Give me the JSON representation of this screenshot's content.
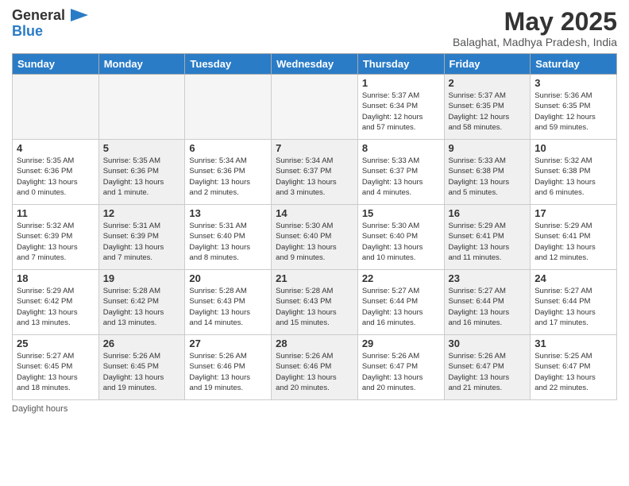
{
  "header": {
    "logo_line1": "General",
    "logo_line2": "Blue",
    "month_title": "May 2025",
    "location": "Balaghat, Madhya Pradesh, India"
  },
  "days_of_week": [
    "Sunday",
    "Monday",
    "Tuesday",
    "Wednesday",
    "Thursday",
    "Friday",
    "Saturday"
  ],
  "weeks": [
    [
      {
        "day": "",
        "info": "",
        "shaded": false,
        "empty": true
      },
      {
        "day": "",
        "info": "",
        "shaded": false,
        "empty": true
      },
      {
        "day": "",
        "info": "",
        "shaded": false,
        "empty": true
      },
      {
        "day": "",
        "info": "",
        "shaded": false,
        "empty": true
      },
      {
        "day": "1",
        "info": "Sunrise: 5:37 AM\nSunset: 6:34 PM\nDaylight: 12 hours\nand 57 minutes.",
        "shaded": false,
        "empty": false
      },
      {
        "day": "2",
        "info": "Sunrise: 5:37 AM\nSunset: 6:35 PM\nDaylight: 12 hours\nand 58 minutes.",
        "shaded": true,
        "empty": false
      },
      {
        "day": "3",
        "info": "Sunrise: 5:36 AM\nSunset: 6:35 PM\nDaylight: 12 hours\nand 59 minutes.",
        "shaded": false,
        "empty": false
      }
    ],
    [
      {
        "day": "4",
        "info": "Sunrise: 5:35 AM\nSunset: 6:36 PM\nDaylight: 13 hours\nand 0 minutes.",
        "shaded": false,
        "empty": false
      },
      {
        "day": "5",
        "info": "Sunrise: 5:35 AM\nSunset: 6:36 PM\nDaylight: 13 hours\nand 1 minute.",
        "shaded": true,
        "empty": false
      },
      {
        "day": "6",
        "info": "Sunrise: 5:34 AM\nSunset: 6:36 PM\nDaylight: 13 hours\nand 2 minutes.",
        "shaded": false,
        "empty": false
      },
      {
        "day": "7",
        "info": "Sunrise: 5:34 AM\nSunset: 6:37 PM\nDaylight: 13 hours\nand 3 minutes.",
        "shaded": true,
        "empty": false
      },
      {
        "day": "8",
        "info": "Sunrise: 5:33 AM\nSunset: 6:37 PM\nDaylight: 13 hours\nand 4 minutes.",
        "shaded": false,
        "empty": false
      },
      {
        "day": "9",
        "info": "Sunrise: 5:33 AM\nSunset: 6:38 PM\nDaylight: 13 hours\nand 5 minutes.",
        "shaded": true,
        "empty": false
      },
      {
        "day": "10",
        "info": "Sunrise: 5:32 AM\nSunset: 6:38 PM\nDaylight: 13 hours\nand 6 minutes.",
        "shaded": false,
        "empty": false
      }
    ],
    [
      {
        "day": "11",
        "info": "Sunrise: 5:32 AM\nSunset: 6:39 PM\nDaylight: 13 hours\nand 7 minutes.",
        "shaded": false,
        "empty": false
      },
      {
        "day": "12",
        "info": "Sunrise: 5:31 AM\nSunset: 6:39 PM\nDaylight: 13 hours\nand 7 minutes.",
        "shaded": true,
        "empty": false
      },
      {
        "day": "13",
        "info": "Sunrise: 5:31 AM\nSunset: 6:40 PM\nDaylight: 13 hours\nand 8 minutes.",
        "shaded": false,
        "empty": false
      },
      {
        "day": "14",
        "info": "Sunrise: 5:30 AM\nSunset: 6:40 PM\nDaylight: 13 hours\nand 9 minutes.",
        "shaded": true,
        "empty": false
      },
      {
        "day": "15",
        "info": "Sunrise: 5:30 AM\nSunset: 6:40 PM\nDaylight: 13 hours\nand 10 minutes.",
        "shaded": false,
        "empty": false
      },
      {
        "day": "16",
        "info": "Sunrise: 5:29 AM\nSunset: 6:41 PM\nDaylight: 13 hours\nand 11 minutes.",
        "shaded": true,
        "empty": false
      },
      {
        "day": "17",
        "info": "Sunrise: 5:29 AM\nSunset: 6:41 PM\nDaylight: 13 hours\nand 12 minutes.",
        "shaded": false,
        "empty": false
      }
    ],
    [
      {
        "day": "18",
        "info": "Sunrise: 5:29 AM\nSunset: 6:42 PM\nDaylight: 13 hours\nand 13 minutes.",
        "shaded": false,
        "empty": false
      },
      {
        "day": "19",
        "info": "Sunrise: 5:28 AM\nSunset: 6:42 PM\nDaylight: 13 hours\nand 13 minutes.",
        "shaded": true,
        "empty": false
      },
      {
        "day": "20",
        "info": "Sunrise: 5:28 AM\nSunset: 6:43 PM\nDaylight: 13 hours\nand 14 minutes.",
        "shaded": false,
        "empty": false
      },
      {
        "day": "21",
        "info": "Sunrise: 5:28 AM\nSunset: 6:43 PM\nDaylight: 13 hours\nand 15 minutes.",
        "shaded": true,
        "empty": false
      },
      {
        "day": "22",
        "info": "Sunrise: 5:27 AM\nSunset: 6:44 PM\nDaylight: 13 hours\nand 16 minutes.",
        "shaded": false,
        "empty": false
      },
      {
        "day": "23",
        "info": "Sunrise: 5:27 AM\nSunset: 6:44 PM\nDaylight: 13 hours\nand 16 minutes.",
        "shaded": true,
        "empty": false
      },
      {
        "day": "24",
        "info": "Sunrise: 5:27 AM\nSunset: 6:44 PM\nDaylight: 13 hours\nand 17 minutes.",
        "shaded": false,
        "empty": false
      }
    ],
    [
      {
        "day": "25",
        "info": "Sunrise: 5:27 AM\nSunset: 6:45 PM\nDaylight: 13 hours\nand 18 minutes.",
        "shaded": false,
        "empty": false
      },
      {
        "day": "26",
        "info": "Sunrise: 5:26 AM\nSunset: 6:45 PM\nDaylight: 13 hours\nand 19 minutes.",
        "shaded": true,
        "empty": false
      },
      {
        "day": "27",
        "info": "Sunrise: 5:26 AM\nSunset: 6:46 PM\nDaylight: 13 hours\nand 19 minutes.",
        "shaded": false,
        "empty": false
      },
      {
        "day": "28",
        "info": "Sunrise: 5:26 AM\nSunset: 6:46 PM\nDaylight: 13 hours\nand 20 minutes.",
        "shaded": true,
        "empty": false
      },
      {
        "day": "29",
        "info": "Sunrise: 5:26 AM\nSunset: 6:47 PM\nDaylight: 13 hours\nand 20 minutes.",
        "shaded": false,
        "empty": false
      },
      {
        "day": "30",
        "info": "Sunrise: 5:26 AM\nSunset: 6:47 PM\nDaylight: 13 hours\nand 21 minutes.",
        "shaded": true,
        "empty": false
      },
      {
        "day": "31",
        "info": "Sunrise: 5:25 AM\nSunset: 6:47 PM\nDaylight: 13 hours\nand 22 minutes.",
        "shaded": false,
        "empty": false
      }
    ]
  ],
  "footer": {
    "label": "Daylight hours"
  }
}
